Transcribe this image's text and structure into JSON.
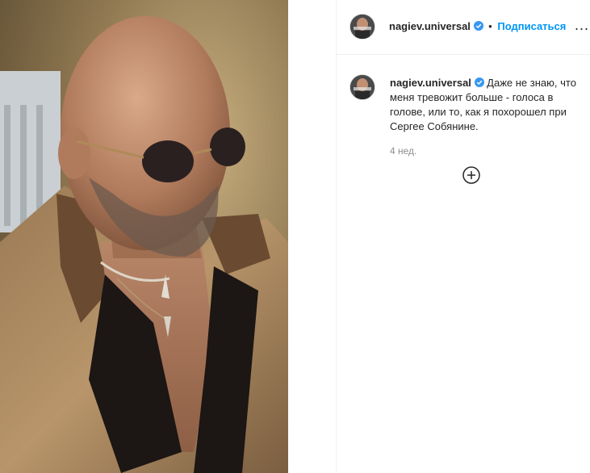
{
  "post": {
    "username": "nagiev.universal",
    "follow_label": "Подписаться",
    "separator": "•",
    "more_label": "...",
    "caption": "Даже не знаю, что меня тревожит больше - голоса в голове, или то, как я похорошел при Сергее Собянине.",
    "time_ago": "4 нед.",
    "icons": {
      "verified": "verified-badge-icon",
      "more": "more-options-icon",
      "load_more": "plus-circle-icon"
    },
    "colors": {
      "accent": "#0095f6",
      "text": "#262626",
      "muted": "#8e8e8e",
      "border": "#efefef"
    }
  }
}
